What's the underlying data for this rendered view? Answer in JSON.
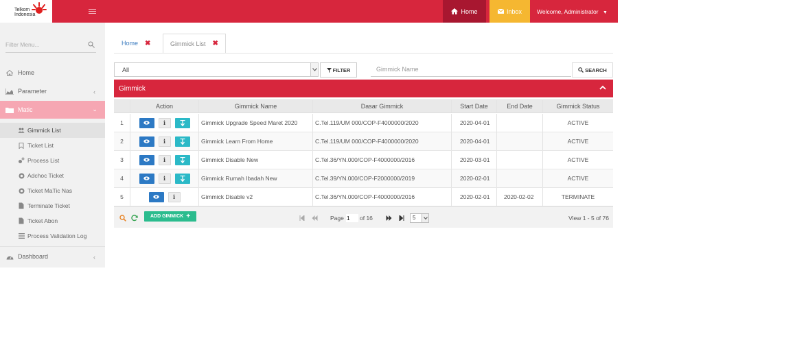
{
  "colors": {
    "brand": "#d7263d",
    "home_nav": "#a81730",
    "inbox_nav": "#f5b731",
    "view_button": "#2c79c4",
    "terminate_button": "#2bb9c7",
    "add_button": "#2bbc8e"
  },
  "header": {
    "logo_line1": "Telkom",
    "logo_line2": "Indonesia",
    "home_label": "Home",
    "inbox_label": "Inbox",
    "welcome": "Welcome, Administrator"
  },
  "sidebar": {
    "filter_placeholder": "Filter Menu...",
    "items": [
      {
        "label": "Home",
        "icon": "home-icon"
      },
      {
        "label": "Parameter",
        "icon": "chart-icon"
      },
      {
        "label": "Matic",
        "icon": "folder-icon"
      },
      {
        "label": "Dashboard",
        "icon": "dashboard-icon"
      }
    ],
    "sub_items": [
      {
        "label": "Gimmick List",
        "icon": "users-icon"
      },
      {
        "label": "Ticket List",
        "icon": "bookmark-icon"
      },
      {
        "label": "Process List",
        "icon": "gears-icon"
      },
      {
        "label": "Adchoc Ticket",
        "icon": "circle-icon"
      },
      {
        "label": "Ticket MaTic Nas",
        "icon": "circle-icon"
      },
      {
        "label": "Terminate Ticket",
        "icon": "file-icon"
      },
      {
        "label": "Ticket Abon",
        "icon": "file-icon"
      },
      {
        "label": "Process Validation Log",
        "icon": "list-icon"
      }
    ]
  },
  "tabs": [
    {
      "label": "Home"
    },
    {
      "label": "Gimmick List"
    }
  ],
  "filters": {
    "select_value": "All",
    "filter_button": "FILTER",
    "name_placeholder": "Gimmick Name",
    "search_button": "SEARCH"
  },
  "panel": {
    "title": "Gimmick"
  },
  "table": {
    "headers": [
      "Action",
      "Gimmick Name",
      "Dasar Gimmick",
      "Start Date",
      "End Date",
      "Gimmick Status"
    ],
    "rows": [
      {
        "no": "1",
        "name": "Gimmick Upgrade Speed Maret 2020",
        "dasar": "C.Tel.119/UM 000/COP-F4000000/2020",
        "start": "2020-04-01",
        "end": "",
        "status": "ACTIVE"
      },
      {
        "no": "2",
        "name": "Gimmick Learn From Home",
        "dasar": "C.Tel.119/UM 000/COP-F4000000/2020",
        "start": "2020-04-01",
        "end": "",
        "status": "ACTIVE"
      },
      {
        "no": "3",
        "name": "Gimmick Disable New",
        "dasar": "C.Tel.36/YN.000/COP-F4000000/2016",
        "start": "2020-03-01",
        "end": "",
        "status": "ACTIVE"
      },
      {
        "no": "4",
        "name": "Gimmick Rumah Ibadah New",
        "dasar": "C.Tel.39/YN.000/COP-F2000000/2019",
        "start": "2020-02-01",
        "end": "",
        "status": "ACTIVE"
      },
      {
        "no": "5",
        "name": "Gimmick Disable v2",
        "dasar": "C.Tel.36/YN.000/COP-F4000000/2016",
        "start": "2020-02-01",
        "end": "2020-02-02",
        "status": "TERMINATE"
      }
    ]
  },
  "pager": {
    "add_button": "ADD GIMMICK",
    "page_label": "Page",
    "page_value": "1",
    "of_label": "of 16",
    "page_size": "5",
    "view_text": "View 1 - 5 of 76"
  }
}
